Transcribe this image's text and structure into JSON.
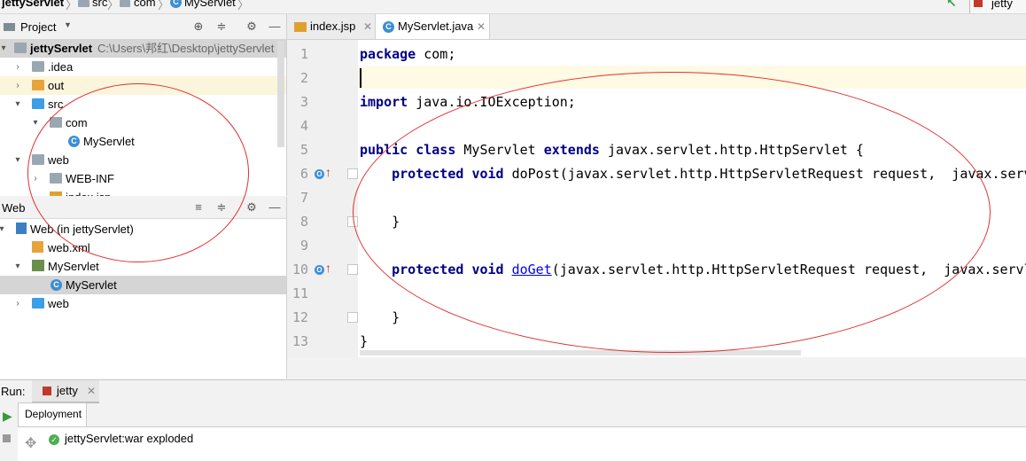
{
  "breadcrumb": [
    "jettyServlet",
    "src",
    "com",
    "MyServlet"
  ],
  "toolbar": {
    "run_config": "jetty"
  },
  "project_panel": {
    "title": "Project",
    "tree": [
      {
        "label": "jettyServlet",
        "path": "C:\\Users\\邦红\\Desktop\\jettyServlet",
        "expanded": true
      },
      {
        "label": ".idea",
        "expanded": false
      },
      {
        "label": "out",
        "expanded": false
      },
      {
        "label": "src",
        "expanded": true
      },
      {
        "label": "com",
        "expanded": true
      },
      {
        "label": "MyServlet"
      },
      {
        "label": "web",
        "expanded": true
      },
      {
        "label": "WEB-INF",
        "expanded": false
      },
      {
        "label": "index.jsp"
      }
    ]
  },
  "web_panel": {
    "title": "Web",
    "tree": [
      {
        "label": "Web (in jettyServlet)"
      },
      {
        "label": "web.xml"
      },
      {
        "label": "MyServlet"
      },
      {
        "label": "MyServlet"
      },
      {
        "label": "web"
      }
    ]
  },
  "editor": {
    "tabs": [
      {
        "label": "index.jsp",
        "active": false
      },
      {
        "label": "MyServlet.java",
        "active": true
      }
    ],
    "line_numbers": [
      "1",
      "2",
      "3",
      "4",
      "5",
      "6",
      "7",
      "8",
      "9",
      "10",
      "11",
      "12",
      "13"
    ],
    "code": {
      "l1_kw": "package",
      "l1_rest": " com;",
      "l3_kw": "import",
      "l3_rest": " java.io.IOException;",
      "l5_kw1": "public",
      "l5_kw2": "class",
      "l5_name": " MyServlet ",
      "l5_kw3": "extends",
      "l5_rest": " javax.servlet.http.HttpServlet {",
      "l6_kw1": "protected",
      "l6_kw2": "void",
      "l6_rest": " doPost(javax.servlet.http.HttpServletRequest request,  javax.servlet.http.HttpServletResponse response)",
      "l8": "}",
      "l10_kw1": "protected",
      "l10_kw2": "void",
      "l10_method": "doGet",
      "l10_rest": "(javax.servlet.http.HttpServletRequest request,  javax.servlet.http.HttpServletResponse response)",
      "l12": "}",
      "l13": "}"
    },
    "gutter_marker": "O"
  },
  "run_panel": {
    "label": "Run:",
    "tab": "jetty",
    "deployment_tab": "Deployment",
    "status": "jettyServlet:war exploded"
  },
  "colors": {
    "keyword": "#000080",
    "annotation_circle": "#e03030",
    "current_line": "#fffae3"
  }
}
